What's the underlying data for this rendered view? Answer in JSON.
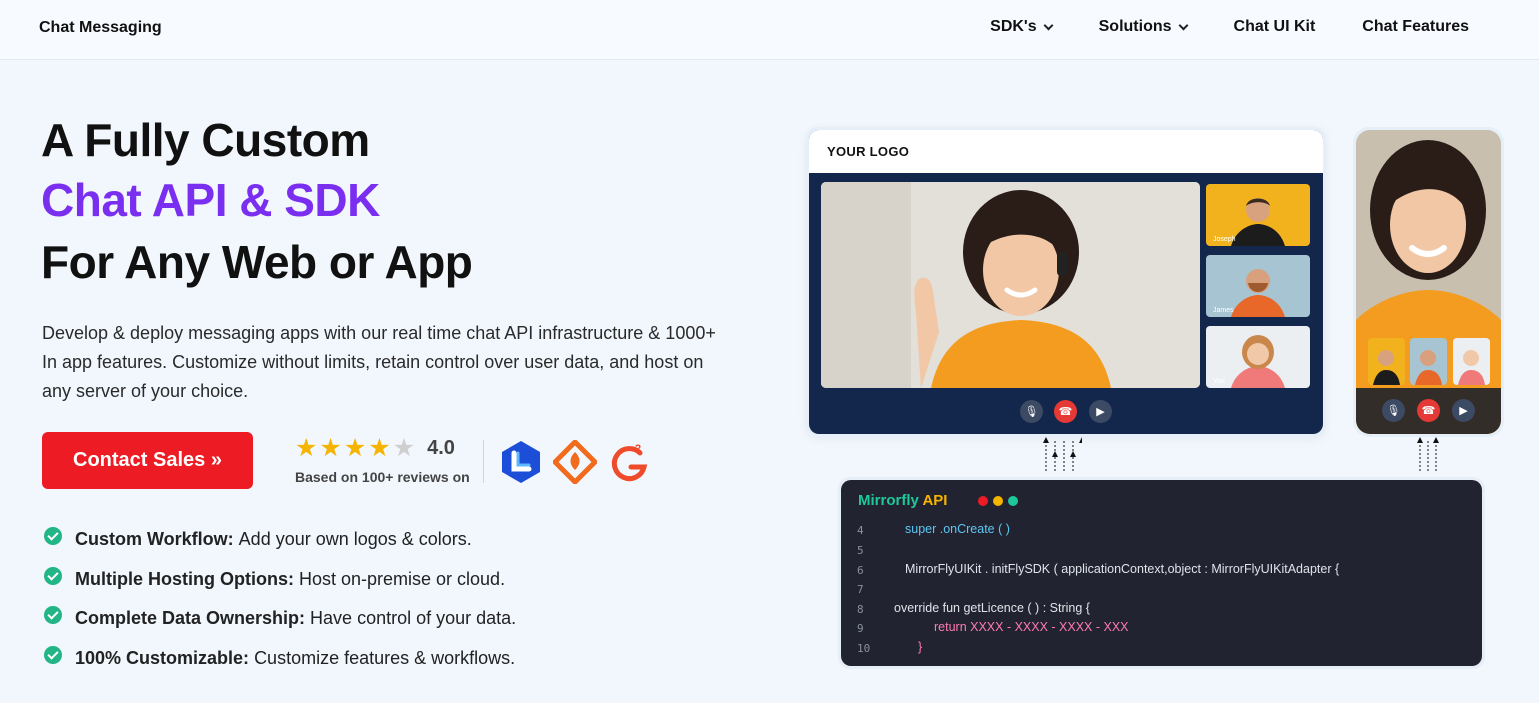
{
  "header": {
    "brand": "Chat Messaging",
    "nav": [
      {
        "label": "SDK's",
        "dropdown": true
      },
      {
        "label": "Solutions",
        "dropdown": true
      },
      {
        "label": "Chat UI Kit",
        "dropdown": false
      },
      {
        "label": "Chat Features",
        "dropdown": false
      }
    ]
  },
  "hero": {
    "line1": "A Fully Custom",
    "line2": "Chat API & SDK",
    "line3": "For Any Web or App",
    "description": "Develop & deploy messaging apps with our real time chat API infrastructure & 1000+ In app features. Customize without limits, retain control over user data, and host on any server of your choice.",
    "cta": "Contact Sales »",
    "rating": {
      "score": "4.0",
      "stars": 4,
      "max": 5,
      "text": "Based on 100+ reviews on"
    },
    "features": [
      {
        "title": "Custom Workflow:",
        "text": "Add your own logos & colors."
      },
      {
        "title": "Multiple Hosting Options:",
        "text": "Host on-premise or cloud."
      },
      {
        "title": "Complete Data Ownership:",
        "text": "Have control of your data."
      },
      {
        "title": "100% Customizable:",
        "text": "Customize features & workflows."
      }
    ],
    "accent_color": "#7a2ff0",
    "cta_color": "#ed1c24",
    "check_color": "#22b585"
  },
  "illustration": {
    "logo_text": "YOUR LOGO",
    "participants": [
      "Joseph",
      "James",
      "You"
    ],
    "code": {
      "title_a": "Mirrorfly",
      "title_b": "API",
      "lines": [
        {
          "n": "4",
          "text": "super .onCreate ( )"
        },
        {
          "n": "5",
          "text": ""
        },
        {
          "n": "6",
          "text": "MirrorFlyUIKit . initFlySDK ( applicationContext,object : MirrorFlyUIKitAdapter {"
        },
        {
          "n": "7",
          "text": ""
        },
        {
          "n": "8",
          "text": "override fun getLicence ( ) : String {"
        },
        {
          "n": "9",
          "text": "return XXXX - XXXX - XXXX - XXX"
        },
        {
          "n": "10",
          "text": "}"
        }
      ]
    }
  }
}
